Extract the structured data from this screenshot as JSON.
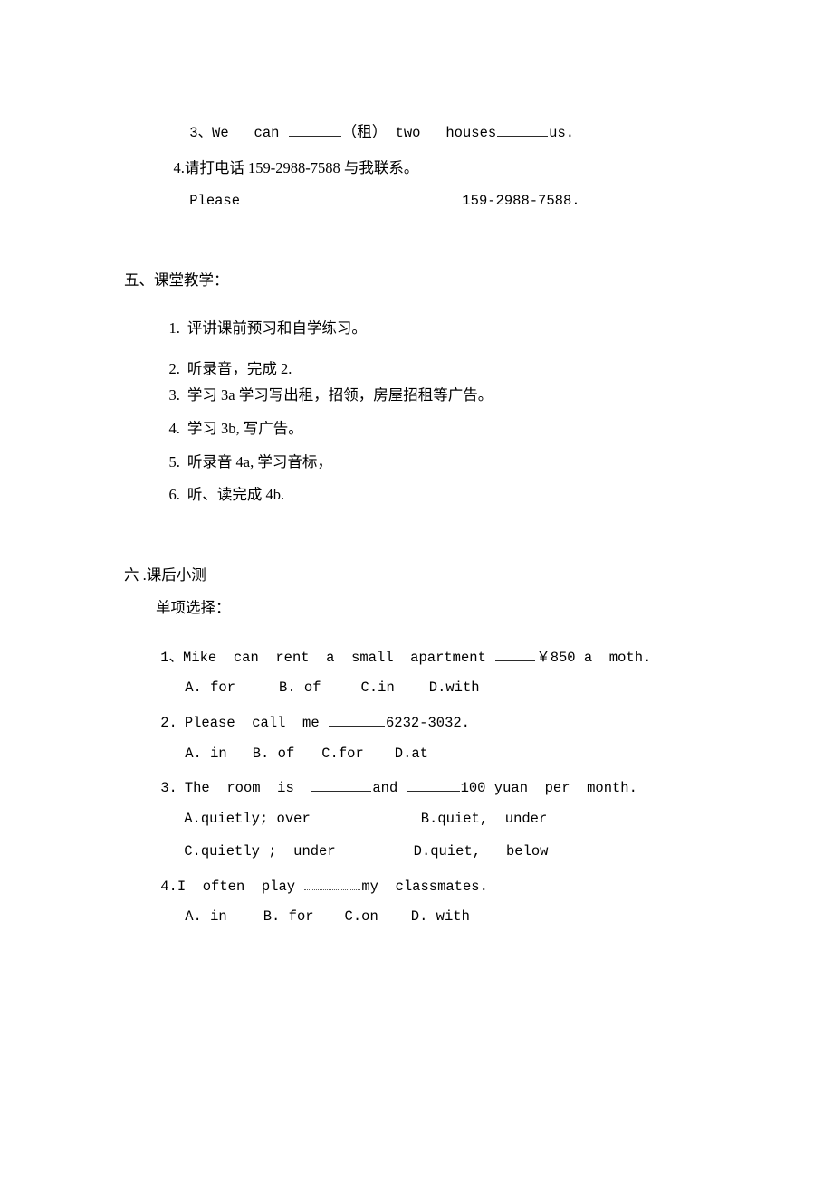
{
  "document": {
    "type": "worksheet-page",
    "page_background": "#ffffff",
    "text_color": "#000000"
  },
  "section_exercises_cont": {
    "item3": {
      "number": "3、",
      "text_before": "We   can ",
      "blank1": "______",
      "hint": "（租）",
      "text_mid": " two   houses",
      "blank2": "_______",
      "text_end": "us."
    },
    "item4": {
      "number": "4.",
      "text": "请打电话 159-2988-7588 与我联系。"
    },
    "item4_answer": {
      "lead": "Please ",
      "blank1": "________",
      "blank2": "_________",
      "blank3": "__________",
      "tail": "159-2988-7588."
    }
  },
  "section_five": {
    "heading": "五、课堂教学：",
    "items": [
      {
        "number": "1.",
        "text": "评讲课前预习和自学练习。"
      },
      {
        "number": "2.",
        "text": "听录音，完成 2."
      },
      {
        "number": "3.",
        "text": "学习 3a 学习写出租，招领，房屋招租等广告。"
      },
      {
        "number": "4.",
        "text": "学习 3b, 写广告。"
      },
      {
        "number": "5.",
        "text": "听录音 4a, 学习音标，"
      },
      {
        "number": "6.",
        "text": "听、读完成 4b."
      }
    ]
  },
  "section_six": {
    "heading": "六 .课后小测",
    "subheading": "单项选择：",
    "questions": [
      {
        "number": "1、",
        "stem_before": "Mike  can  rent  a  small  apartment ",
        "stem_blank": "_____",
        "stem_after": "￥850 a  moth.",
        "options": [
          "A. for",
          "B. of",
          "C.in",
          "D.with"
        ],
        "options_layout": "single-row"
      },
      {
        "number": "2.",
        "stem_before": "Please  call  me ",
        "stem_blank": "________",
        "stem_after": "6232-3032.",
        "options": [
          "A. in",
          "B. of",
          "C.for",
          "D.at"
        ],
        "options_layout": "single-row"
      },
      {
        "number": "3.",
        "stem_before": "The  room  is  ",
        "stem_blank1": "________",
        "stem_mid": "and ",
        "stem_blank2": "_______",
        "stem_after": "100 yuan  per  month.",
        "options": [
          "A.quietly; over",
          "B.quiet,  under",
          "C.quietly ;  under",
          "D.quiet,   below"
        ],
        "options_layout": "two-by-two"
      },
      {
        "number": "4.",
        "stem_before": "I  often  play ",
        "stem_blank": "________",
        "stem_after": "my  classmates.",
        "options": [
          "A. in",
          "B. for",
          "C.on",
          "D. with"
        ],
        "options_layout": "single-row"
      }
    ]
  }
}
